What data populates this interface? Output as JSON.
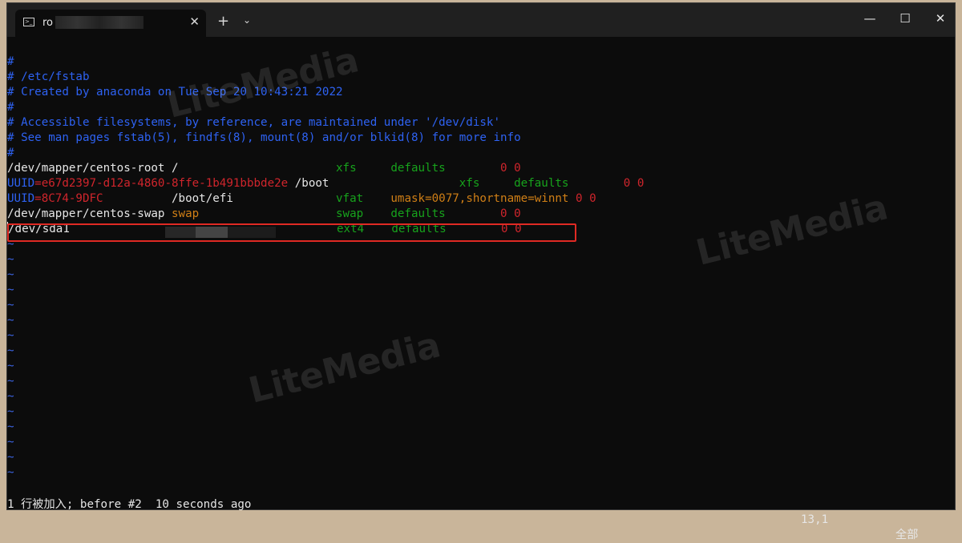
{
  "window": {
    "tab_title": "ro",
    "tab_icon_glyph": ">_",
    "close_tab": "✕",
    "new_tab": "+",
    "dropdown": "⌄",
    "minimize": "—",
    "maximize": "☐",
    "close": "✕"
  },
  "editor": {
    "lines": [
      {
        "segments": [
          {
            "text": "#",
            "color": "blue"
          }
        ]
      },
      {
        "segments": [
          {
            "text": "# /etc/fstab",
            "color": "blue"
          }
        ]
      },
      {
        "segments": [
          {
            "text": "# Created by anaconda on Tue Sep 20 10:43:21 2022",
            "color": "blue"
          }
        ]
      },
      {
        "segments": [
          {
            "text": "#",
            "color": "blue"
          }
        ]
      },
      {
        "segments": [
          {
            "text": "# Accessible filesystems, by reference, are maintained under '/dev/disk'",
            "color": "blue"
          }
        ]
      },
      {
        "segments": [
          {
            "text": "# See man pages fstab(5), findfs(8), mount(8) and/or blkid(8) for more info",
            "color": "blue"
          }
        ]
      },
      {
        "segments": [
          {
            "text": "#",
            "color": "blue"
          }
        ]
      },
      {
        "segments": [
          {
            "text": "/dev/mapper/centos-root /                       ",
            "color": "white"
          },
          {
            "text": "xfs     ",
            "color": "green"
          },
          {
            "text": "defaults        ",
            "color": "green"
          },
          {
            "text": "0 0",
            "color": "red"
          }
        ]
      },
      {
        "segments": [
          {
            "text": "UUID",
            "color": "blue"
          },
          {
            "text": "=e67d2397-d12a-4860-8ffe-1b491bbbde2e ",
            "color": "red"
          },
          {
            "text": "/boot                   ",
            "color": "white"
          },
          {
            "text": "xfs     ",
            "color": "green"
          },
          {
            "text": "defaults        ",
            "color": "green"
          },
          {
            "text": "0 0",
            "color": "red"
          }
        ]
      },
      {
        "segments": [
          {
            "text": "UUID",
            "color": "blue"
          },
          {
            "text": "=8C74-9DFC          ",
            "color": "red"
          },
          {
            "text": "/boot/efi               ",
            "color": "white"
          },
          {
            "text": "vfat    ",
            "color": "green"
          },
          {
            "text": "umask=0077,shortname=winnt ",
            "color": "orange"
          },
          {
            "text": "0 0",
            "color": "red"
          }
        ]
      },
      {
        "segments": [
          {
            "text": "/dev/mapper/centos-swap ",
            "color": "white"
          },
          {
            "text": "swap                    ",
            "color": "orange"
          },
          {
            "text": "swap    ",
            "color": "green"
          },
          {
            "text": "defaults        ",
            "color": "green"
          },
          {
            "text": "0 0",
            "color": "red"
          }
        ]
      },
      {
        "segments": [
          {
            "text": "/dev/sda1                                       ",
            "color": "white"
          },
          {
            "text": "ext4    ",
            "color": "green"
          },
          {
            "text": "defaults        ",
            "color": "green"
          },
          {
            "text": "0 0",
            "color": "red"
          }
        ]
      }
    ],
    "tilde": "~",
    "tilde_count": 16
  },
  "status": {
    "message": "1 行被加入; before #2  10 seconds ago",
    "position": "13,1",
    "scroll": "全部"
  },
  "watermark": "LiteMedia",
  "colors": {
    "blue": "#2e62f2",
    "white": "#e6e6e6",
    "red": "#d0252c",
    "green": "#17a31c",
    "orange": "#d07f16",
    "tilde": "#3b63e0",
    "highlight_border": "#e02a24"
  }
}
